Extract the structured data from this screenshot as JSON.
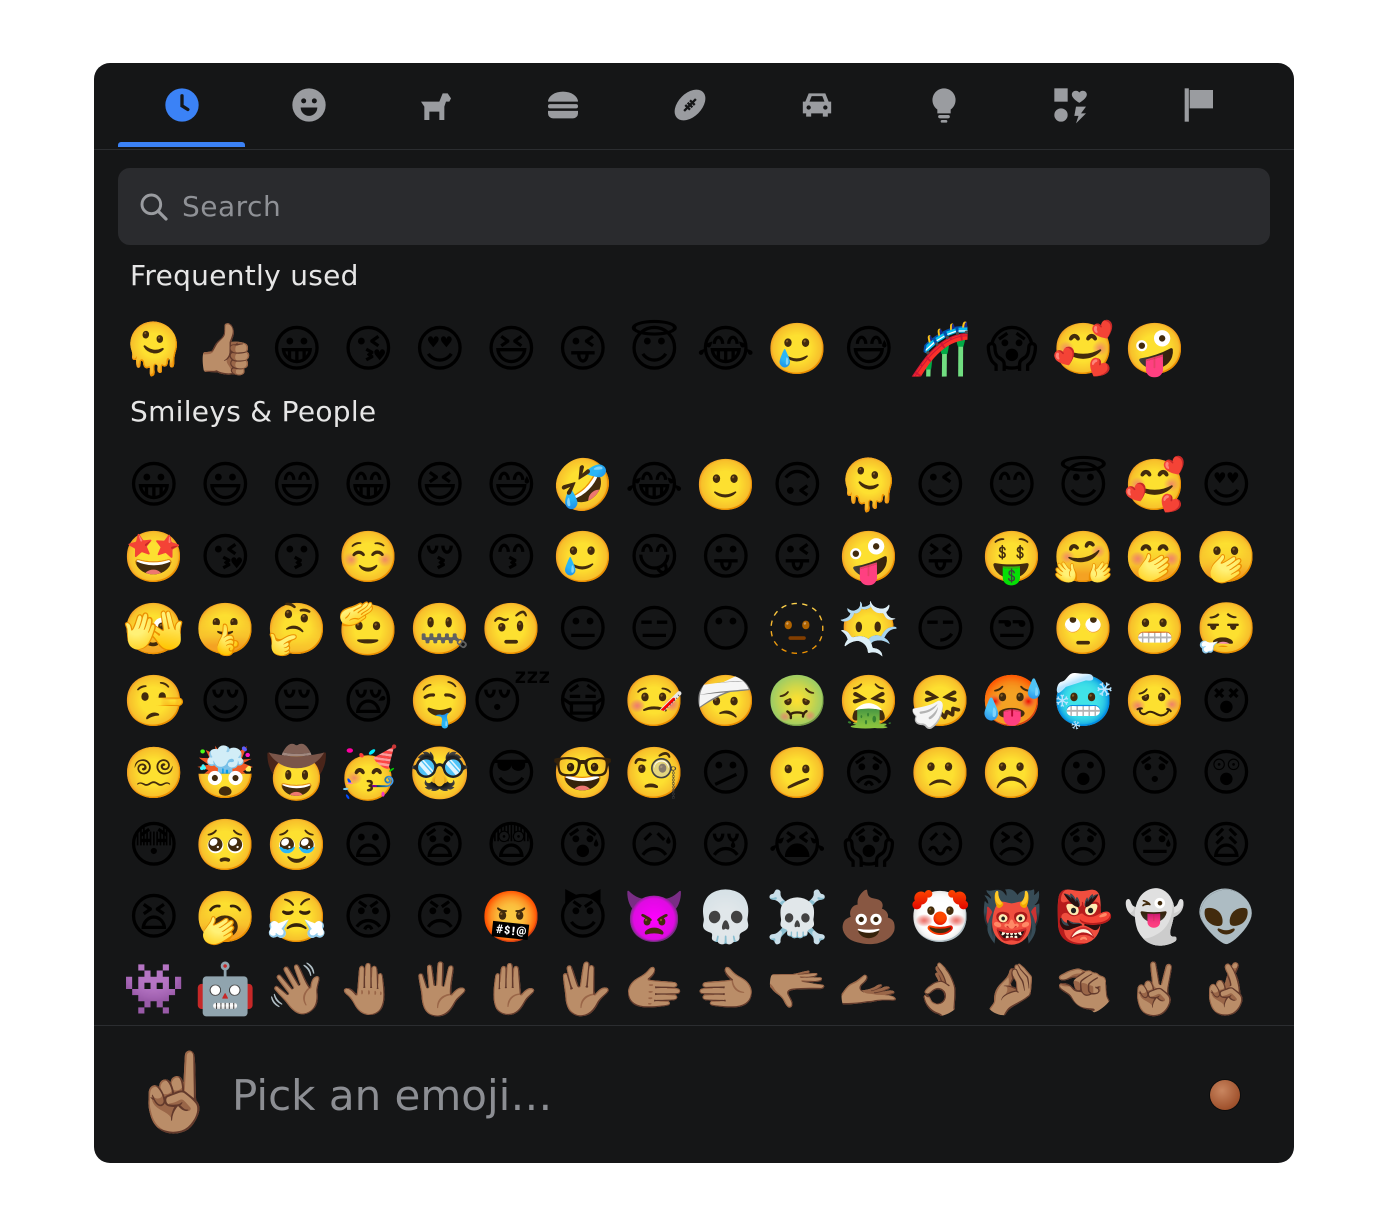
{
  "tabs": [
    {
      "name": "tab-frequent",
      "icon": "clock-icon",
      "active": true
    },
    {
      "name": "tab-smileys",
      "icon": "smiley-icon",
      "active": false
    },
    {
      "name": "tab-animals",
      "icon": "dog-icon",
      "active": false
    },
    {
      "name": "tab-food",
      "icon": "burger-icon",
      "active": false
    },
    {
      "name": "tab-activities",
      "icon": "football-icon",
      "active": false
    },
    {
      "name": "tab-travel",
      "icon": "car-icon",
      "active": false
    },
    {
      "name": "tab-objects",
      "icon": "lightbulb-icon",
      "active": false
    },
    {
      "name": "tab-symbols",
      "icon": "symbols-icon",
      "active": false
    },
    {
      "name": "tab-flags",
      "icon": "flag-icon",
      "active": false
    }
  ],
  "colors": {
    "accent": "#3b82f6",
    "tab_icon": "#9a9ca0",
    "background": "#151617",
    "search_bg": "#2a2b2e"
  },
  "search": {
    "placeholder": "Search"
  },
  "categories": [
    {
      "title": "Frequently used",
      "emojis": [
        "🫠",
        "👍🏽",
        "😀",
        "😘",
        "😍",
        "😆",
        "😜",
        "😇",
        "😂",
        "🥲",
        "😅",
        "🎢",
        "😱",
        "🥰",
        "🤪"
      ]
    },
    {
      "title": "Smileys & People",
      "emojis": [
        "😀",
        "😃",
        "😄",
        "😁",
        "😆",
        "😅",
        "🤣",
        "😂",
        "🙂",
        "🙃",
        "🫠",
        "😉",
        "😊",
        "😇",
        "🥰",
        "😍",
        "🤩",
        "😘",
        "😗",
        "☺️",
        "😚",
        "😙",
        "🥲",
        "😋",
        "😛",
        "😜",
        "🤪",
        "😝",
        "🤑",
        "🤗",
        "🤭",
        "🫢",
        "🫣",
        "🤫",
        "🤔",
        "🫡",
        "🤐",
        "🤨",
        "😐",
        "😑",
        "😶",
        "🫥",
        "😶‍🌫️",
        "😏",
        "😒",
        "🙄",
        "😬",
        "😮‍💨",
        "🤥",
        "😌",
        "😔",
        "😪",
        "🤤",
        "😴",
        "😷",
        "🤒",
        "🤕",
        "🤢",
        "🤮",
        "🤧",
        "🥵",
        "🥶",
        "🥴",
        "😵",
        "😵‍💫",
        "🤯",
        "🤠",
        "🥳",
        "🥸",
        "😎",
        "🤓",
        "🧐",
        "😕",
        "🫤",
        "😟",
        "🙁",
        "☹️",
        "😮",
        "😯",
        "😲",
        "😳",
        "🥺",
        "🥹",
        "😦",
        "😧",
        "😨",
        "😰",
        "😥",
        "😢",
        "😭",
        "😱",
        "😖",
        "😣",
        "😞",
        "😓",
        "😩",
        "😫",
        "🥱",
        "😤",
        "😡",
        "😠",
        "🤬",
        "😈",
        "👿",
        "💀",
        "☠️",
        "💩",
        "🤡",
        "👹",
        "👺",
        "👻",
        "👽",
        "👾",
        "🤖",
        "👋🏽",
        "🤚🏽",
        "🖐🏽",
        "✋🏽",
        "🖖🏽",
        "🫱🏽",
        "🫲🏽",
        "🫳🏽",
        "🫴🏽",
        "👌🏽",
        "🤌🏽",
        "🤏🏽",
        "✌🏽",
        "🤞🏽"
      ]
    }
  ],
  "preview": {
    "emoji": "☝🏽",
    "placeholder": "Pick an emoji…"
  }
}
